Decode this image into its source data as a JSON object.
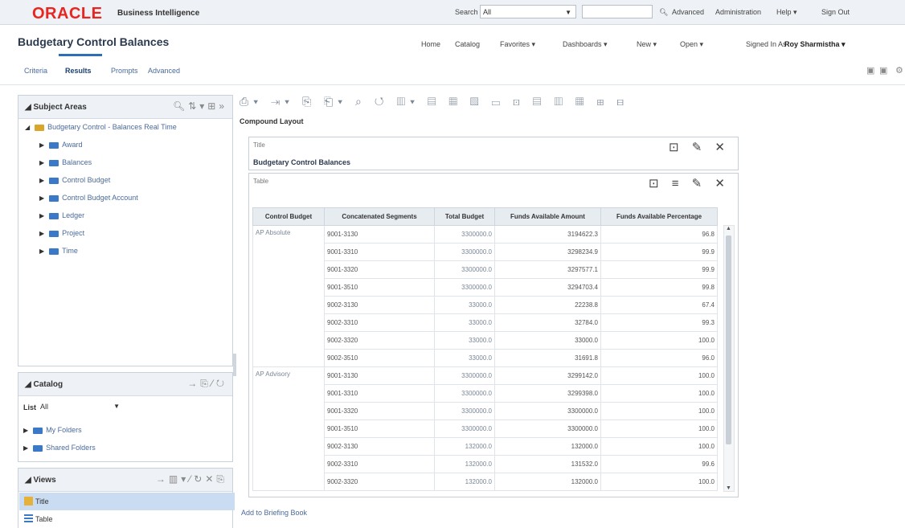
{
  "app": {
    "logo": "ORACLE",
    "logo_sub": "Business Intelligence",
    "search_label": "Search",
    "search_scope": "All",
    "top_links": [
      "Advanced",
      "Administration",
      "Help ▾",
      "Sign Out"
    ]
  },
  "header": {
    "title": "Budgetary Control Balances",
    "nav": [
      "Home",
      "Catalog",
      "Favorites ▾",
      "Dashboards ▾",
      "New ▾",
      "Open ▾"
    ],
    "signed_in_label": "Signed In As",
    "user": "Roy Sharmistha ▾"
  },
  "tabs": [
    "Criteria",
    "Results",
    "Prompts",
    "Advanced"
  ],
  "active_tab": "Results",
  "subject_areas": {
    "title": "Subject Areas",
    "root": "Budgetary Control - Balances Real Time",
    "items": [
      "Award",
      "Balances",
      "Control Budget",
      "Control Budget Account",
      "Ledger",
      "Project",
      "Time"
    ]
  },
  "catalog": {
    "title": "Catalog",
    "list_label": "List",
    "list_value": "All",
    "folders": [
      "My Folders",
      "Shared Folders"
    ]
  },
  "views": {
    "title": "Views",
    "items": [
      "Title",
      "Table"
    ],
    "selected": "Title"
  },
  "compound_layout": "Compound Layout",
  "title_view": {
    "label": "Title",
    "title": "Budgetary Control Balances"
  },
  "table_view": {
    "label": "Table",
    "columns": [
      "Control Budget",
      "Concatenated Segments",
      "Total Budget",
      "Funds Available Amount",
      "Funds Available Percentage"
    ],
    "rows": [
      [
        "AP Absolute",
        "9001-3130",
        "3300000.0",
        "3194622.3",
        "96.8"
      ],
      [
        "",
        "9001-3310",
        "3300000.0",
        "3298234.9",
        "99.9"
      ],
      [
        "",
        "9001-3320",
        "3300000.0",
        "3297577.1",
        "99.9"
      ],
      [
        "",
        "9001-3510",
        "3300000.0",
        "3294703.4",
        "99.8"
      ],
      [
        "",
        "9002-3130",
        "33000.0",
        "22238.8",
        "67.4"
      ],
      [
        "",
        "9002-3310",
        "33000.0",
        "32784.0",
        "99.3"
      ],
      [
        "",
        "9002-3320",
        "33000.0",
        "33000.0",
        "100.0"
      ],
      [
        "",
        "9002-3510",
        "33000.0",
        "31691.8",
        "96.0"
      ],
      [
        "AP Advisory",
        "9001-3130",
        "3300000.0",
        "3299142.0",
        "100.0"
      ],
      [
        "",
        "9001-3310",
        "3300000.0",
        "3299398.0",
        "100.0"
      ],
      [
        "",
        "9001-3320",
        "3300000.0",
        "3300000.0",
        "100.0"
      ],
      [
        "",
        "9001-3510",
        "3300000.0",
        "3300000.0",
        "100.0"
      ],
      [
        "",
        "9002-3130",
        "132000.0",
        "132000.0",
        "100.0"
      ],
      [
        "",
        "9002-3310",
        "132000.0",
        "131532.0",
        "99.6"
      ],
      [
        "",
        "9002-3320",
        "132000.0",
        "132000.0",
        "100.0"
      ]
    ]
  },
  "footer_link": "Add to Briefing Book"
}
